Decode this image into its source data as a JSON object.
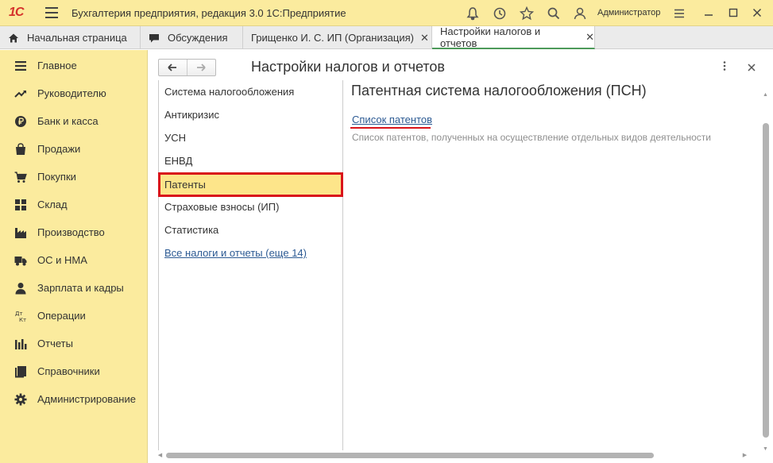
{
  "titlebar": {
    "logo": "1С",
    "app_title": "Бухгалтерия предприятия, редакция 3.0 1С:Предприятие",
    "user": "Администратор"
  },
  "tabs": [
    {
      "label": "Начальная страница",
      "icon": "home-icon"
    },
    {
      "label": "Обсуждения",
      "icon": "chat-icon"
    },
    {
      "label": "Грищенко И. С. ИП (Организация)",
      "close": "✕"
    },
    {
      "label": "Настройки налогов и отчетов",
      "close": "✕",
      "active": true
    }
  ],
  "sidebar": {
    "items": [
      {
        "label": "Главное",
        "icon": "menu-lines-icon"
      },
      {
        "label": "Руководителю",
        "icon": "trend-icon"
      },
      {
        "label": "Банк и касса",
        "icon": "ruble-coin-icon"
      },
      {
        "label": "Продажи",
        "icon": "shopping-bag-icon"
      },
      {
        "label": "Покупки",
        "icon": "cart-icon"
      },
      {
        "label": "Склад",
        "icon": "warehouse-icon"
      },
      {
        "label": "Производство",
        "icon": "factory-icon"
      },
      {
        "label": "ОС и НМА",
        "icon": "truck-icon"
      },
      {
        "label": "Зарплата и кадры",
        "icon": "person-icon"
      },
      {
        "label": "Операции",
        "icon": "dt-kt-icon"
      },
      {
        "label": "Отчеты",
        "icon": "bar-chart-icon"
      },
      {
        "label": "Справочники",
        "icon": "book-icon"
      },
      {
        "label": "Администрирование",
        "icon": "gear-icon"
      }
    ]
  },
  "main": {
    "page_title": "Настройки налогов и отчетов",
    "sections": [
      {
        "label": "Система налогообложения"
      },
      {
        "label": "Антикризис"
      },
      {
        "label": "УСН"
      },
      {
        "label": "ЕНВД"
      },
      {
        "label": "Патенты",
        "selected": true
      },
      {
        "label": "Страховые взносы (ИП)"
      },
      {
        "label": "Статистика"
      },
      {
        "label": "Все налоги и отчеты (еще 14)",
        "link": true
      }
    ],
    "content_title": "Патентная система налогообложения (ПСН)",
    "patent_link": "Список патентов",
    "patent_desc": "Список патентов, полученных на осуществление отдельных видов деятельности"
  },
  "colors": {
    "accent_yellow": "#fbeb9e",
    "selection_red": "#d9141b",
    "link_blue": "#2c5a93",
    "active_tab_green": "#4d9a5a"
  }
}
